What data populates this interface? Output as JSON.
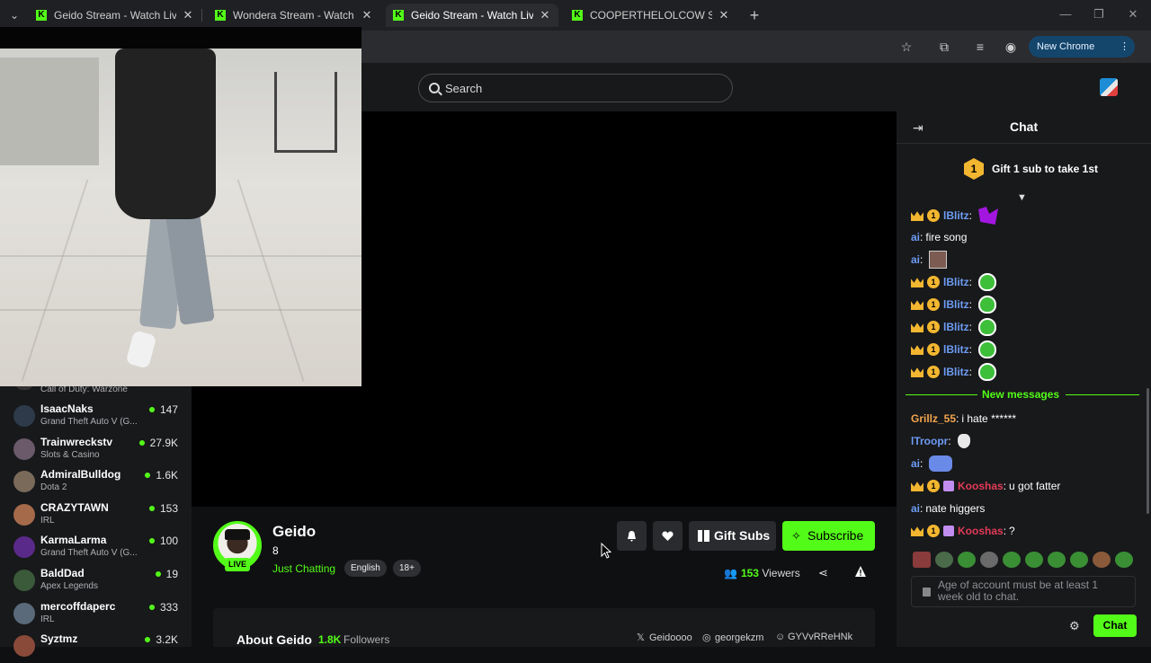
{
  "browser": {
    "tabs": [
      {
        "title": "Geido Stream - Watch Live on Kick",
        "active": false
      },
      {
        "title": "Wondera Stream - Watch Live on Kick",
        "active": false
      },
      {
        "title": "Geido Stream - Watch Live on Kick",
        "active": true
      },
      {
        "title": "COOPERTHELOLCOW Stream - Watch Live on Kick",
        "active": false
      }
    ],
    "tab_close": "✕",
    "new_tab": "+",
    "new_chrome_label": "New Chrome available",
    "window_controls": {
      "minimize": "—",
      "restore": "❐",
      "close": "✕"
    }
  },
  "header": {
    "search_placeholder": "Search"
  },
  "sidebar": {
    "top_partial_category": "Call of Duty: Warzone",
    "channels": [
      {
        "name": "IsaacNaks",
        "category": "Grand Theft Auto V (G...",
        "viewers": "147",
        "avatar_color": "#2e3a4a"
      },
      {
        "name": "Trainwreckstv",
        "category": "Slots & Casino",
        "viewers": "27.9K",
        "avatar_color": "#6a5a6a"
      },
      {
        "name": "AdmiralBulldog",
        "category": "Dota 2",
        "viewers": "1.6K",
        "avatar_color": "#7a6a5a"
      },
      {
        "name": "CRAZYTAWN",
        "category": "IRL",
        "viewers": "153",
        "avatar_color": "#a56a4a"
      },
      {
        "name": "KarmaLarma",
        "category": "Grand Theft Auto V (G...",
        "viewers": "100",
        "avatar_color": "#5a2a8a"
      },
      {
        "name": "BaldDad",
        "category": "Apex Legends",
        "viewers": "19",
        "avatar_color": "#3a5a3a"
      },
      {
        "name": "mercoffdaperc",
        "category": "IRL",
        "viewers": "333",
        "avatar_color": "#5a6a7a"
      },
      {
        "name": "Syztmz",
        "category": "",
        "viewers": "3.2K",
        "avatar_color": "#8a4a3a"
      }
    ]
  },
  "channel": {
    "name": "Geido",
    "sub_line": "8",
    "category": "Just Chatting",
    "tags": [
      "English",
      "18+"
    ],
    "live_label": "LIVE",
    "gift_subs_label": "Gift Subs",
    "subscribe_label": "Subscribe",
    "viewers_count": "153",
    "viewers_label": "Viewers",
    "about_title": "About Geido",
    "followers_count": "1.8K",
    "followers_label": "Followers",
    "socials": [
      {
        "icon": "x-icon",
        "label": "Geidoooo"
      },
      {
        "icon": "instagram-icon",
        "label": "georgekzm"
      },
      {
        "icon": "discord-icon",
        "label": "GYVvRReHNk"
      }
    ]
  },
  "chat": {
    "title": "Chat",
    "gift_banner": "Gift 1 sub to take 1st",
    "gift_rank": "1",
    "new_messages_label": "New messages",
    "messages": [
      {
        "user": "lBlitz",
        "text": "",
        "color": "#6d9cf3",
        "badges": [
          "crown",
          "one"
        ],
        "emote": "s"
      },
      {
        "user": "ai",
        "text": "fire song",
        "color": "#6d9cf3",
        "badges": [],
        "emote": ""
      },
      {
        "user": "ai",
        "text": "",
        "color": "#6d9cf3",
        "badges": [],
        "emote": "f"
      },
      {
        "user": "lBlitz",
        "text": "",
        "color": "#6d9cf3",
        "badges": [
          "crown",
          "one"
        ],
        "emote": "p"
      },
      {
        "user": "lBlitz",
        "text": "",
        "color": "#6d9cf3",
        "badges": [
          "crown",
          "one"
        ],
        "emote": "p"
      },
      {
        "user": "lBlitz",
        "text": "",
        "color": "#6d9cf3",
        "badges": [
          "crown",
          "one"
        ],
        "emote": "p"
      },
      {
        "user": "lBlitz",
        "text": "",
        "color": "#6d9cf3",
        "badges": [
          "crown",
          "one"
        ],
        "emote": "p"
      },
      {
        "user": "lBlitz",
        "text": "",
        "color": "#6d9cf3",
        "badges": [
          "crown",
          "one"
        ],
        "emote": "p"
      },
      {
        "user": "Grillz_55",
        "text": "i hate ******",
        "color": "#f2a44c",
        "badges": [],
        "emote": ""
      },
      {
        "user": "lTroopr",
        "text": "",
        "color": "#6d9cf3",
        "badges": [],
        "emote": "h"
      },
      {
        "user": "ai",
        "text": "",
        "color": "#6d9cf3",
        "badges": [],
        "emote": "b"
      },
      {
        "user": "Kooshas",
        "text": "u got fatter",
        "color": "#e23a57",
        "badges": [
          "crown",
          "one",
          "gift"
        ],
        "emote": ""
      },
      {
        "user": "ai",
        "text": "nate higgers",
        "color": "#6d9cf3",
        "badges": [],
        "emote": ""
      },
      {
        "user": "Kooshas",
        "text": "?",
        "color": "#e23a57",
        "badges": [
          "crown",
          "one",
          "gift"
        ],
        "emote": ""
      }
    ],
    "input_placeholder": "Age of account must be at least 1 week old to chat.",
    "send_label": "Chat"
  },
  "colors": {
    "accent": "#53fc18",
    "background": "#0f1012",
    "panel": "#18191b"
  }
}
